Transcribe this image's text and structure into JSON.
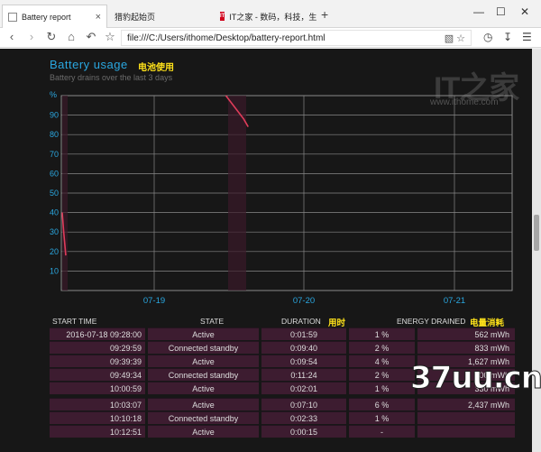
{
  "tabs": [
    {
      "label": "Battery report",
      "close": "×"
    },
    {
      "label": "猎豹起始页"
    },
    {
      "label": "IT之家 - 数码，科技，生活",
      "favicon_text": "IT"
    }
  ],
  "window": {
    "new_tab": "+",
    "minimize": "—",
    "maximize": "☐",
    "close": "✕"
  },
  "toolbar": {
    "url": "file:///C:/Users/ithome/Desktop/battery-report.html",
    "icons": [
      "back-icon",
      "forward-icon",
      "refresh-icon",
      "home-icon",
      "undo-icon",
      "star-icon",
      "translate-icon",
      "star-icon",
      "history-icon",
      "download-icon",
      "menu-icon"
    ]
  },
  "header": {
    "title": "Battery usage",
    "title_cn": "电池使用",
    "subtitle": "Battery drains over the last 3 days"
  },
  "watermark": {
    "logo": "IT之家",
    "url": "www.ithome.com"
  },
  "chart_data": {
    "type": "line",
    "y_unit": "%",
    "y_ticks": [
      10,
      20,
      30,
      40,
      50,
      60,
      70,
      80,
      90
    ],
    "ylim": [
      0,
      100
    ],
    "x_ticks": [
      "07-19",
      "07-20",
      "07-21"
    ],
    "series": [
      {
        "segments": [
          {
            "points": [
              [
                0.0,
                40
              ],
              [
                0.05,
                30
              ],
              [
                0.12,
                18
              ]
            ]
          },
          {
            "points": [
              [
                5.5,
                100
              ],
              [
                6.1,
                88
              ],
              [
                6.25,
                84
              ]
            ]
          }
        ]
      }
    ],
    "grid": true,
    "colors": {
      "line": "#e03c5a",
      "axis_labels": "#2aa7e0",
      "grid": "#888888"
    }
  },
  "table": {
    "headers": {
      "start": "START TIME",
      "state": "STATE",
      "duration": "DURATION",
      "duration_cn": "用时",
      "energy": "ENERGY DRAINED",
      "energy_cn": "电量消耗"
    },
    "rows": [
      {
        "start": "2016-07-18 09:28:00",
        "state": "Active",
        "duration": "0:01:59",
        "pct": "1 %",
        "mwh": "562 mWh"
      },
      {
        "start": "09:29:59",
        "state": "Connected standby",
        "duration": "0:09:40",
        "pct": "2 %",
        "mwh": "833 mWh"
      },
      {
        "start": "09:39:39",
        "state": "Active",
        "duration": "0:09:54",
        "pct": "4 %",
        "mwh": "1,627 mWh"
      },
      {
        "start": "09:49:34",
        "state": "Connected standby",
        "duration": "0:11:24",
        "pct": "2 %",
        "mwh": "900 mWh"
      },
      {
        "start": "10:00:59",
        "state": "Active",
        "duration": "0:02:01",
        "pct": "1 %",
        "mwh": "330 mWh"
      },
      {
        "start": "10:03:07",
        "state": "Active",
        "duration": "0:07:10",
        "pct": "6 %",
        "mwh": "2,437 mWh"
      },
      {
        "start": "10:10:18",
        "state": "Connected standby",
        "duration": "0:02:33",
        "pct": "1 %",
        "mwh": ""
      },
      {
        "start": "10:12:51",
        "state": "Active",
        "duration": "0:00:15",
        "pct": "-",
        "mwh": ""
      }
    ]
  },
  "site_watermark": "37uu.cn"
}
